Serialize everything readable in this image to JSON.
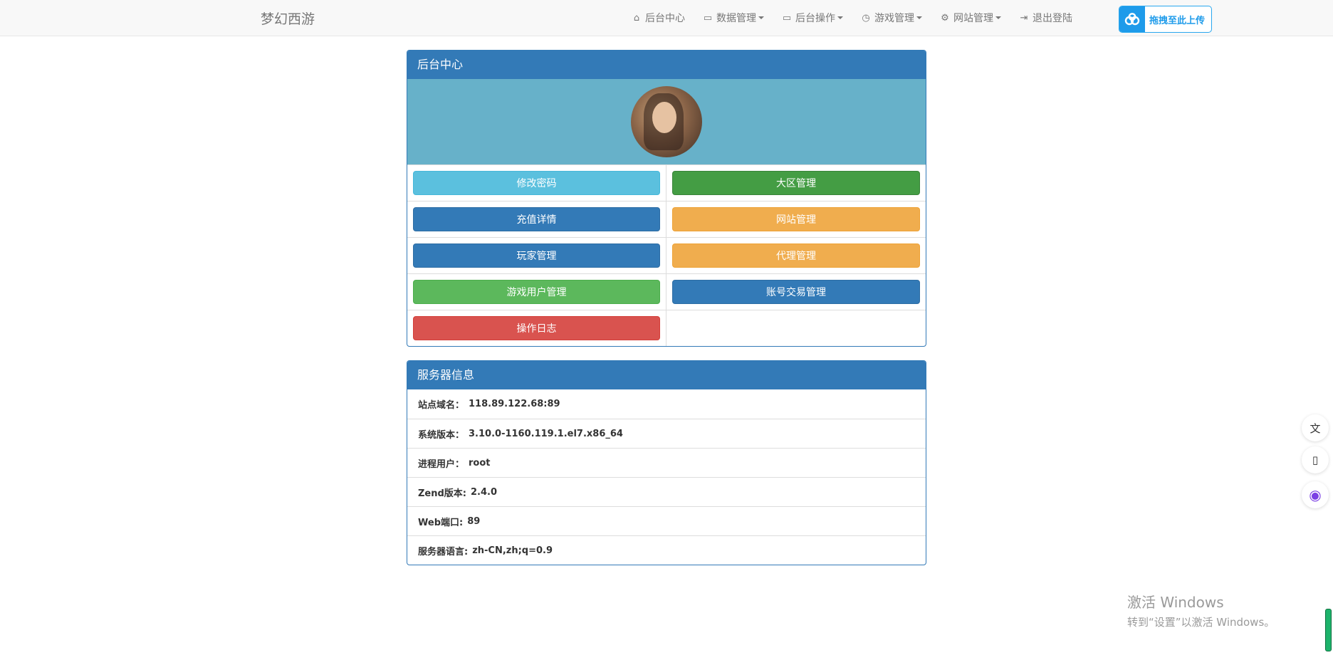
{
  "navbar": {
    "brand": "梦幻西游",
    "items": [
      {
        "label": "后台中心",
        "icon": "home-icon",
        "glyph": "⌂",
        "dropdown": false
      },
      {
        "label": "数据管理",
        "icon": "window-icon",
        "glyph": "▭",
        "dropdown": true
      },
      {
        "label": "后台操作",
        "icon": "window-icon",
        "glyph": "▭",
        "dropdown": true
      },
      {
        "label": "游戏管理",
        "icon": "clock-icon",
        "glyph": "◷",
        "dropdown": true
      },
      {
        "label": "网站管理",
        "icon": "gear-icon",
        "glyph": "⚙",
        "dropdown": true
      },
      {
        "label": "退出登陆",
        "icon": "logout-icon",
        "glyph": "⇥",
        "dropdown": false
      }
    ],
    "upload": {
      "label": "拖拽至此上传",
      "icon": "cloud-drive-icon"
    }
  },
  "center_panel": {
    "title": "后台中心",
    "buttons": [
      {
        "label": "修改密码",
        "style": "btn-info"
      },
      {
        "label": "大区管理",
        "style": "btn-success-dark"
      },
      {
        "label": "充值详情",
        "style": "btn-primary"
      },
      {
        "label": "网站管理",
        "style": "btn-warning"
      },
      {
        "label": "玩家管理",
        "style": "btn-primary"
      },
      {
        "label": "代理管理",
        "style": "btn-warning"
      },
      {
        "label": "游戏用户管理",
        "style": "btn-success"
      },
      {
        "label": "账号交易管理",
        "style": "btn-primary"
      },
      {
        "label": "操作日志",
        "style": "btn-danger"
      }
    ]
  },
  "server_panel": {
    "title": "服务器信息",
    "rows": [
      {
        "key": "站点域名：",
        "value": "118.89.122.68:89"
      },
      {
        "key": "系统版本：",
        "value": "3.10.0-1160.119.1.el7.x86_64"
      },
      {
        "key": "进程用户：",
        "value": "root"
      },
      {
        "key": "Zend版本:",
        "value": "2.4.0"
      },
      {
        "key": "Web端口:",
        "value": "89"
      },
      {
        "key": "服务器语言:",
        "value": "zh-CN,zh;q=0.9"
      }
    ]
  },
  "side_widgets": [
    {
      "icon": "translate-icon",
      "glyph": "文"
    },
    {
      "icon": "reader-icon",
      "glyph": "▯"
    },
    {
      "icon": "assistant-icon",
      "glyph": "◉"
    }
  ],
  "watermark": {
    "line1": "激活 Windows",
    "line2": "转到“设置”以激活 Windows。"
  }
}
